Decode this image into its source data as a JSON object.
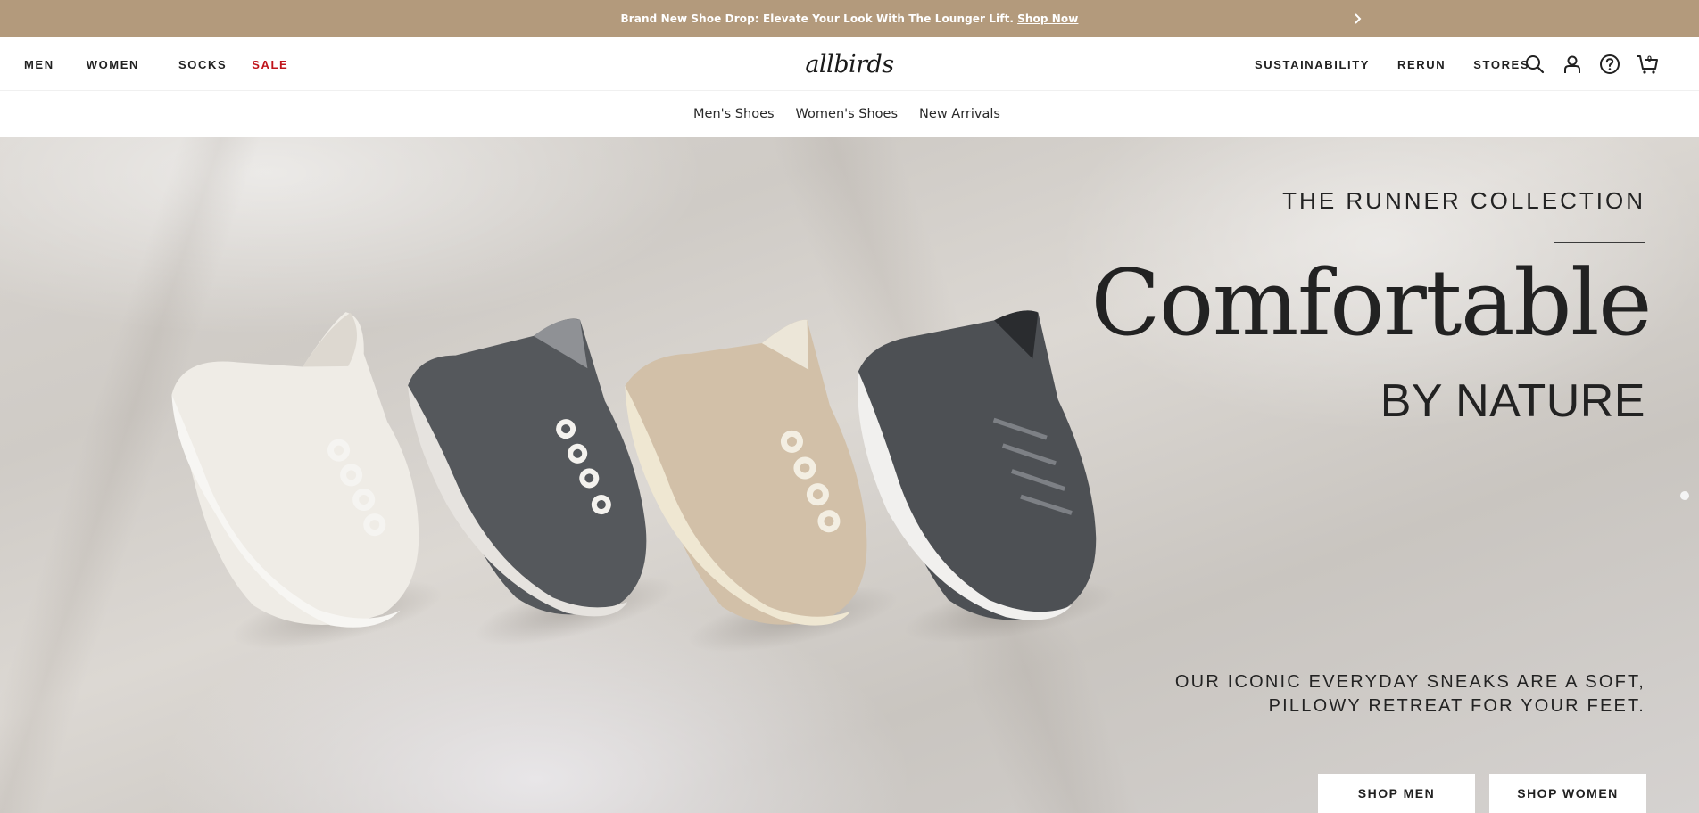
{
  "announcement": {
    "message": "Brand New Shoe Drop: Elevate Your Look With The Lounger Lift.",
    "link_label": "Shop Now",
    "next_icon": "chevron-right-icon"
  },
  "nav": {
    "left_links": [
      {
        "label": "MEN"
      },
      {
        "label": "WOMEN"
      },
      {
        "label": "SOCKS"
      },
      {
        "label": "SALE",
        "color": "#c0141b"
      }
    ],
    "logo": "allbirds",
    "right_links": [
      {
        "label": "SUSTAINABILITY"
      },
      {
        "label": "RERUN"
      },
      {
        "label": "STORES"
      }
    ],
    "icons": [
      "search-icon",
      "account-icon",
      "help-icon",
      "cart-icon"
    ],
    "cart_count": "0"
  },
  "subnav": {
    "links": [
      "Men's Shoes",
      "Women's Shoes",
      "New Arrivals"
    ]
  },
  "hero": {
    "eyebrow": "THE RUNNER COLLECTION",
    "headline": "Comfortable",
    "subhead": "BY NATURE",
    "tagline_line1": "OUR ICONIC EVERYDAY SNEAKS ARE A SOFT,",
    "tagline_line2": "PILLOWY RETREAT FOR YOUR FEET.",
    "cta_men": "SHOP MEN",
    "cta_women": "SHOP WOMEN"
  },
  "colors": {
    "announcement_bg": "#b39a7c",
    "sale_red": "#c0141b",
    "text_dark": "#212121"
  }
}
